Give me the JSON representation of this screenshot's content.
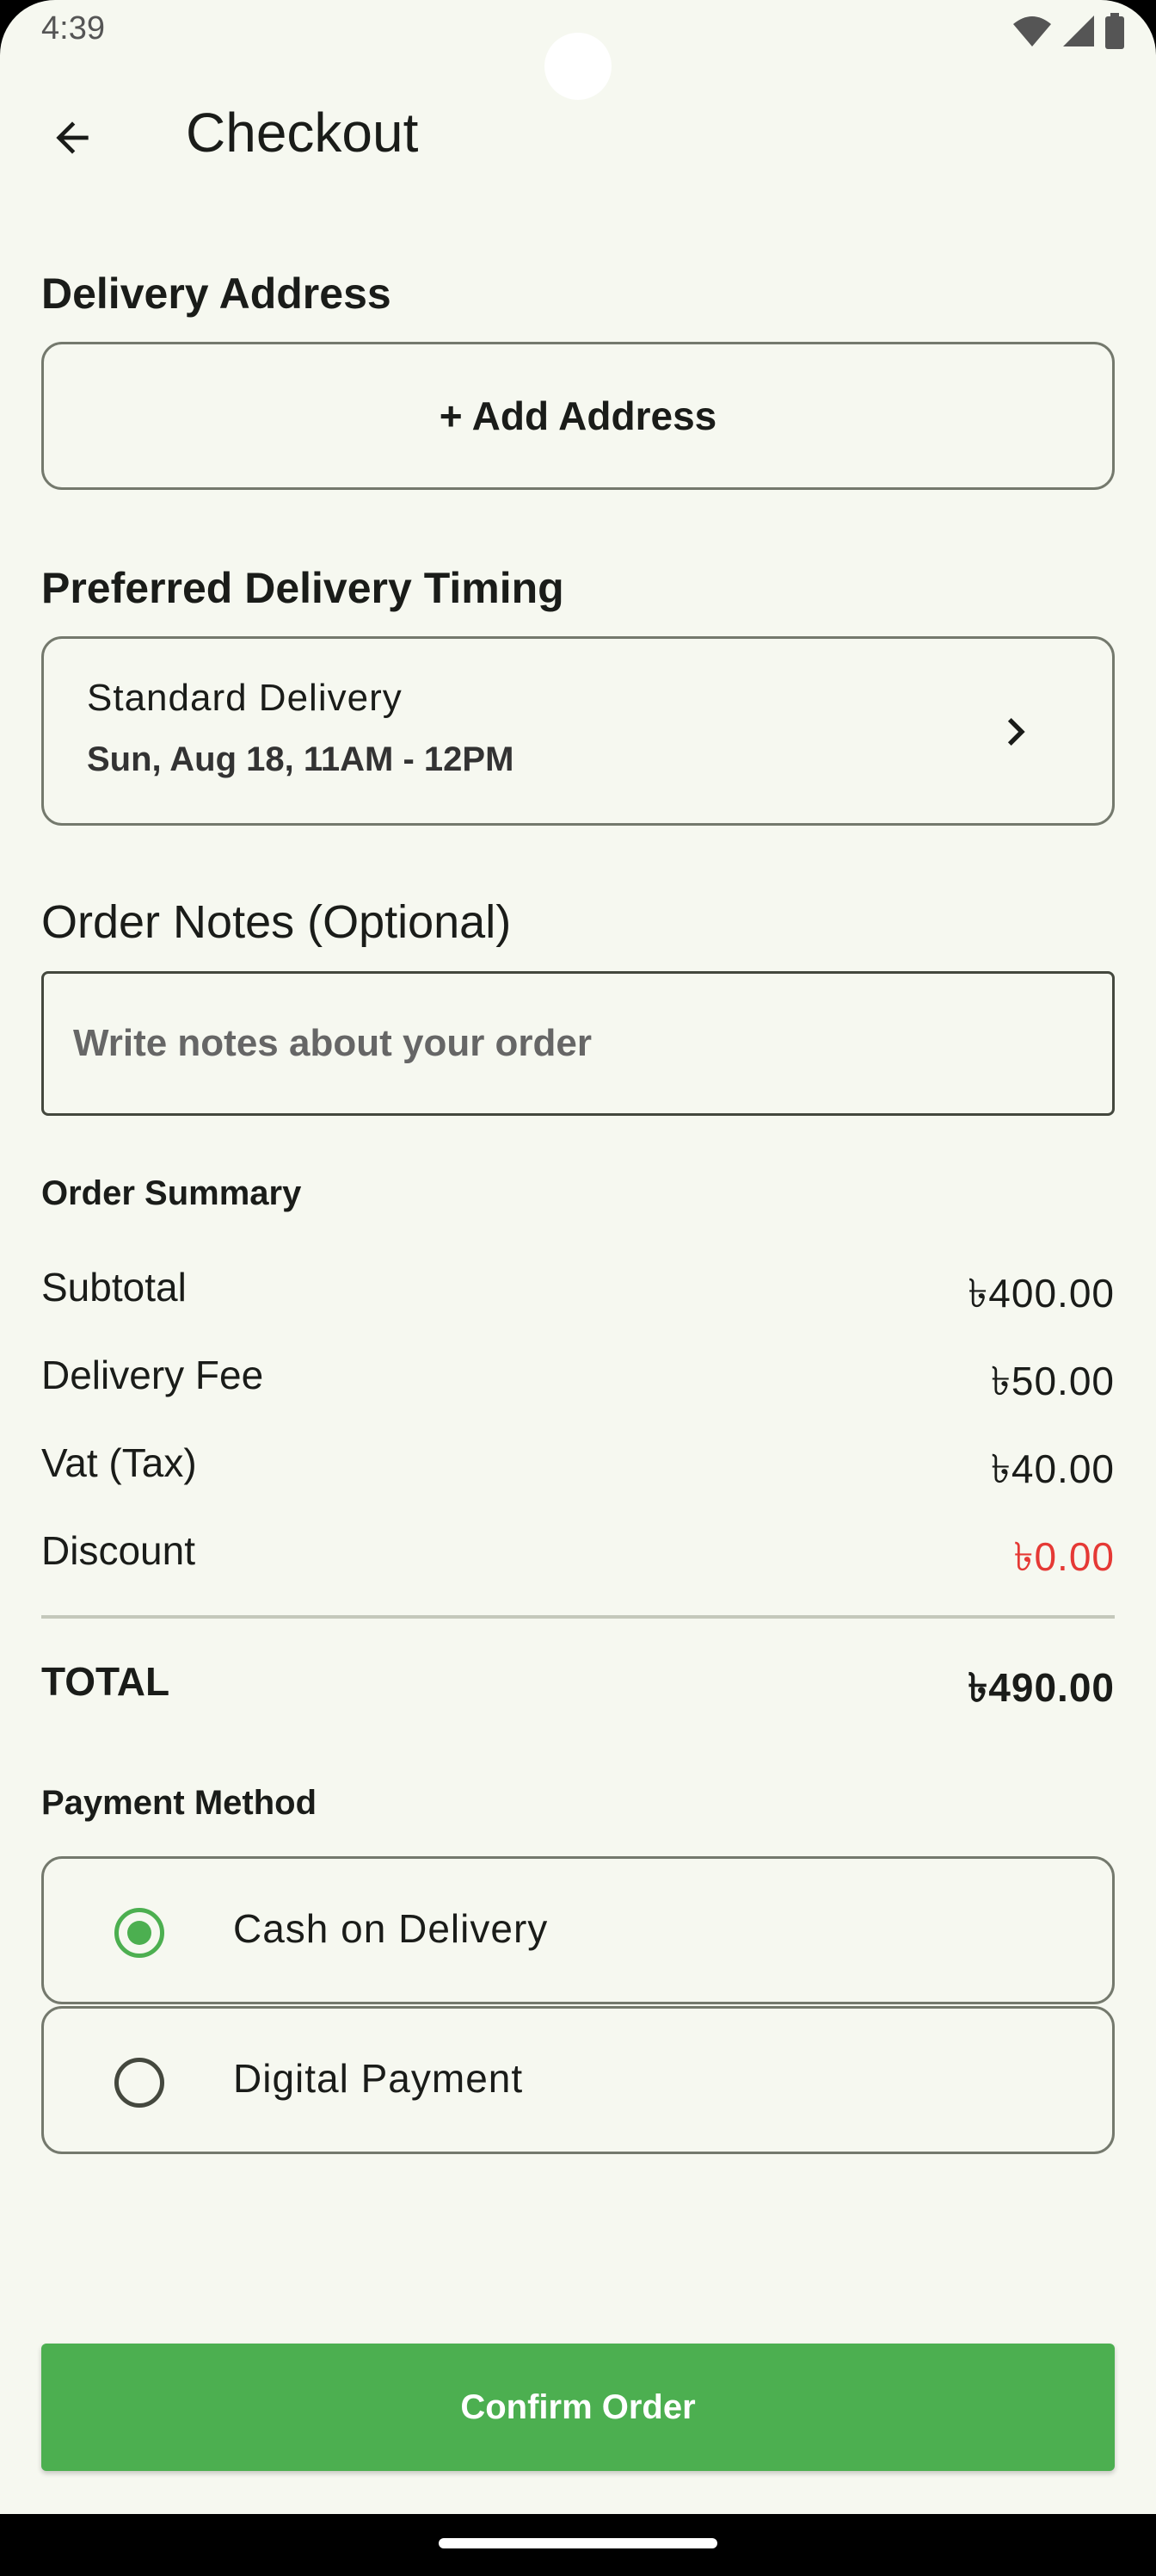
{
  "status_bar": {
    "time": "4:39",
    "icons": [
      "wifi-icon",
      "signal-icon",
      "battery-icon"
    ]
  },
  "app_bar": {
    "title": "Checkout",
    "back_icon": "arrow-back-icon"
  },
  "delivery_address": {
    "title": "Delivery Address",
    "add_button_label": "+ Add Address"
  },
  "delivery_timing": {
    "title": "Preferred Delivery Timing",
    "option_name": "Standard Delivery",
    "option_time": "Sun, Aug 18, 11AM - 12PM",
    "icon": "chevron-right-icon"
  },
  "order_notes": {
    "label": "Order Notes (Optional)",
    "placeholder": "Write notes about your order",
    "value": ""
  },
  "order_summary": {
    "title": "Order Summary",
    "rows": [
      {
        "label": "Subtotal",
        "amount": "৳400.00"
      },
      {
        "label": "Delivery Fee",
        "amount": "৳50.00"
      },
      {
        "label": "Vat (Tax)",
        "amount": "৳40.00"
      },
      {
        "label": "Discount",
        "amount": "৳0.00"
      }
    ],
    "total_label": "TOTAL",
    "total_amount": "৳490.00"
  },
  "payment_method": {
    "title": "Payment Method",
    "options": [
      {
        "label": "Cash on Delivery",
        "selected": true
      },
      {
        "label": "Digital Payment",
        "selected": false
      }
    ]
  },
  "confirm_button": {
    "label": "Confirm Order"
  },
  "colors": {
    "background": "#f6f8f0",
    "accent": "#4caf50",
    "discount": "#e53935",
    "outline": "#74796d"
  }
}
